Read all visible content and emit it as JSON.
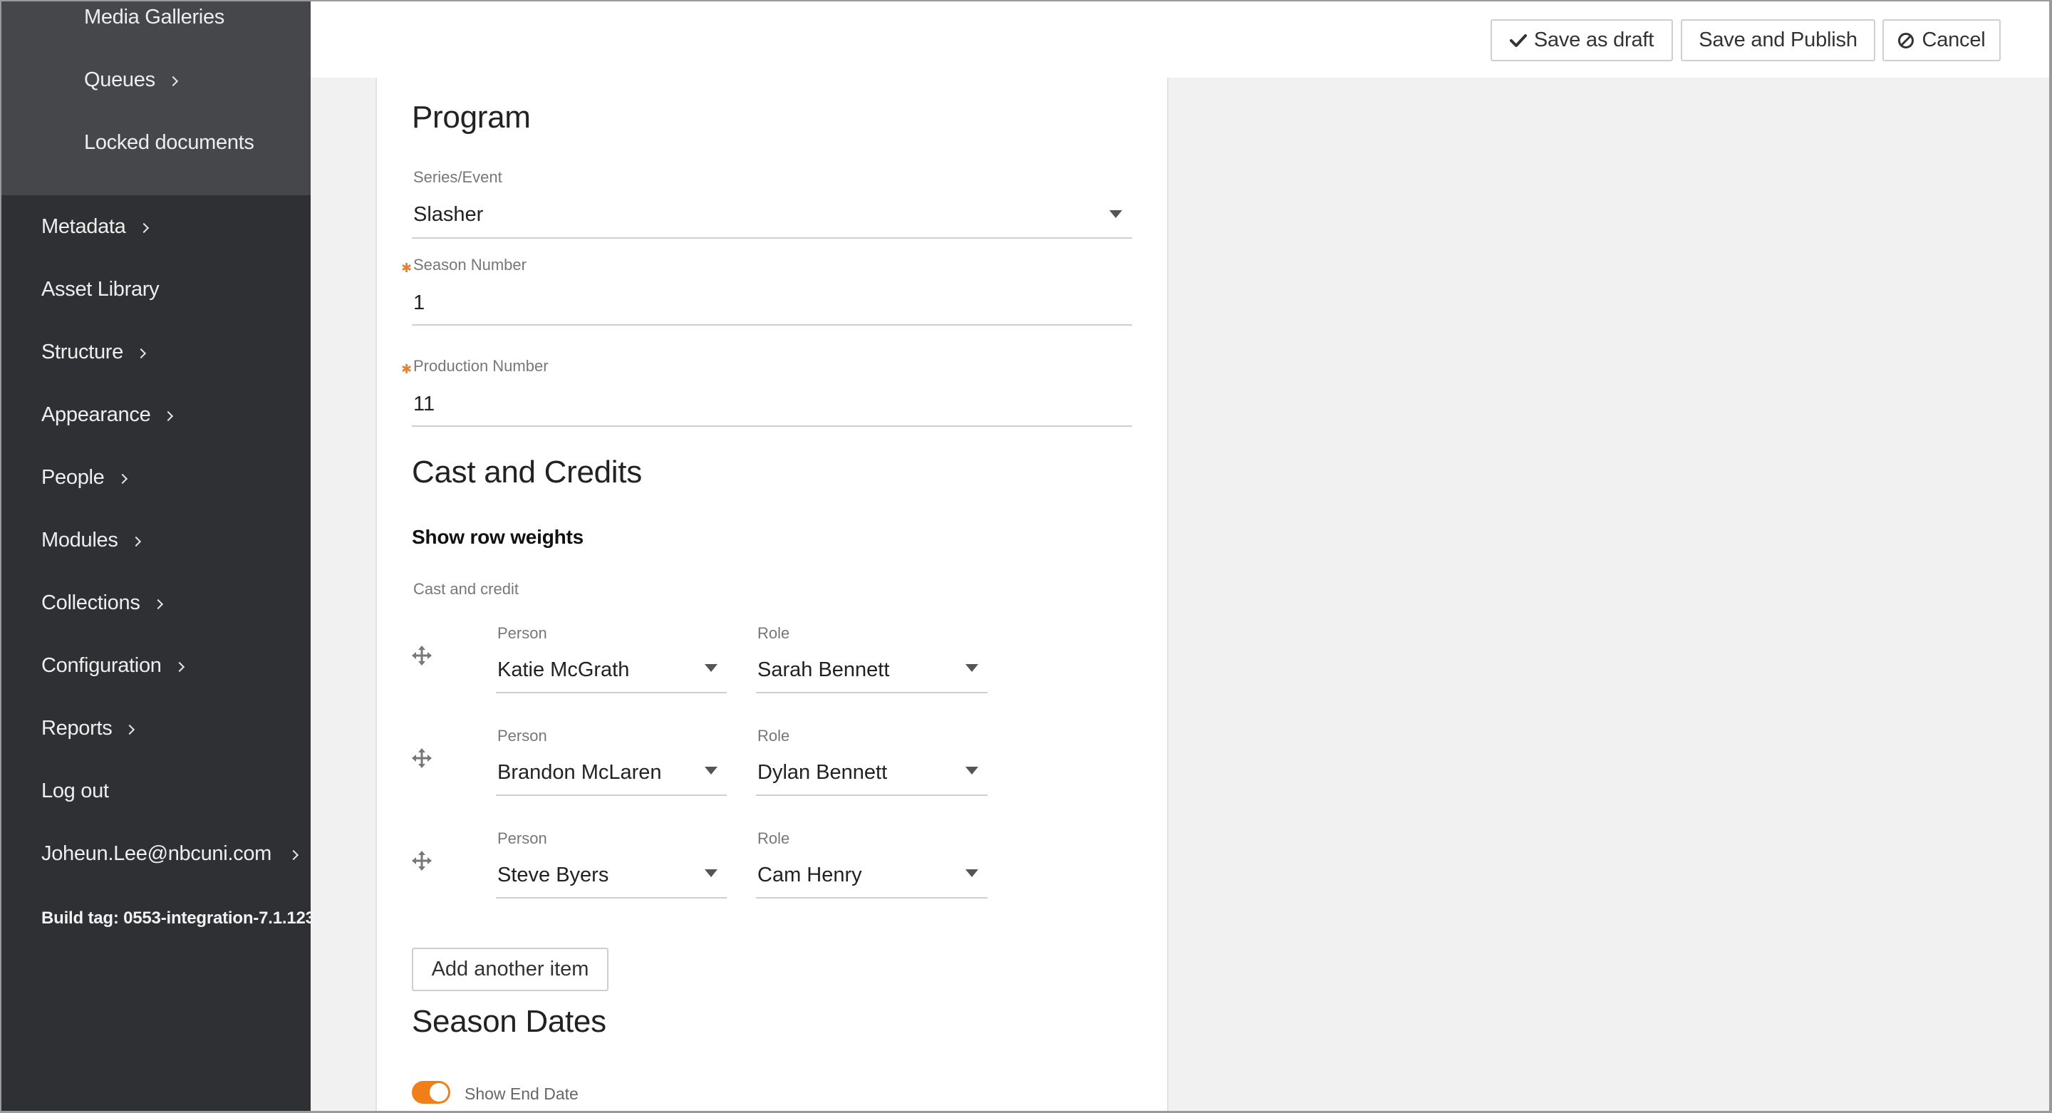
{
  "sidebar": {
    "sub_items": [
      {
        "label": "Media Galleries"
      },
      {
        "label": "Queues"
      },
      {
        "label": "Locked documents"
      }
    ],
    "items": [
      {
        "label": "Metadata"
      },
      {
        "label": "Asset Library"
      },
      {
        "label": "Structure"
      },
      {
        "label": "Appearance"
      },
      {
        "label": "People"
      },
      {
        "label": "Modules"
      },
      {
        "label": "Collections"
      },
      {
        "label": "Configuration"
      },
      {
        "label": "Reports"
      },
      {
        "label": "Log out"
      },
      {
        "label": "Joheun.Lee@nbcuni.com"
      }
    ],
    "build_tag": "Build tag: 0553-integration-7.1.123"
  },
  "toolbar": {
    "save_draft_label": "Save as draft",
    "publish_label": "Save and Publish",
    "cancel_label": "Cancel"
  },
  "program": {
    "heading": "Program",
    "series_label": "Series/Event",
    "series_value": "Slasher",
    "season_number_label": "Season Number",
    "season_number_value": "1",
    "production_number_label": "Production Number",
    "production_number_value": "11"
  },
  "cast": {
    "heading": "Cast and Credits",
    "show_weights": "Show row weights",
    "group_label": "Cast and credit",
    "person_label": "Person",
    "role_label": "Role",
    "rows": [
      {
        "person": "Katie McGrath",
        "role": "Sarah Bennett"
      },
      {
        "person": "Brandon McLaren",
        "role": "Dylan Bennett"
      },
      {
        "person": "Steve Byers",
        "role": "Cam Henry"
      }
    ],
    "add_label": "Add another item"
  },
  "season_dates": {
    "heading": "Season Dates",
    "toggle_label": "Show End Date",
    "toggle_on": true
  },
  "colors": {
    "sidebar_bg": "#2f3033",
    "sidebar_sub_bg": "#45474b",
    "accent_orange": "#f07f1a",
    "required_star": "#e8822a"
  }
}
